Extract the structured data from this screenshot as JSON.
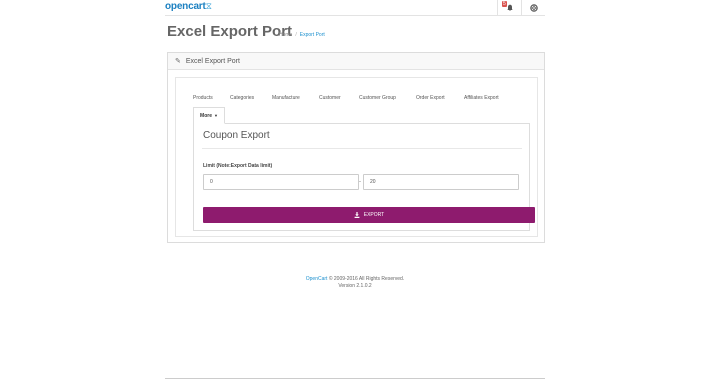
{
  "header": {
    "logo_text": "opencart",
    "logo_cart": "⧖",
    "notification_icon": "bell-icon",
    "notification_count": "5",
    "settings_icon": "life-ring-icon"
  },
  "page": {
    "title": "Excel Export Port",
    "breadcrumb": {
      "home": "Home",
      "separator": "/",
      "current": "Export Port"
    }
  },
  "panel": {
    "heading_icon": "pencil-icon",
    "heading": "Excel Export Port"
  },
  "tabs": {
    "items": [
      "Products",
      "Categories",
      "Manufacture",
      "Customer",
      "Customer Group",
      "Order Export",
      "Affiliates Export"
    ],
    "active": "More"
  },
  "form": {
    "section_title": "Coupon Export",
    "limit_label": "Limit (Note:Export Data limit)",
    "start_value": "0",
    "separator": "-",
    "end_value": "20",
    "export_label": "EXPORT",
    "export_icon": "download-icon"
  },
  "footer": {
    "brand": "OpenCart",
    "copyright": "© 2009-2016 All Rights Reserved.",
    "version": "Version 2.1.0.2"
  },
  "colors": {
    "accent": "#8e1b6e",
    "link": "#1e91cf",
    "badge": "#d9534f"
  }
}
